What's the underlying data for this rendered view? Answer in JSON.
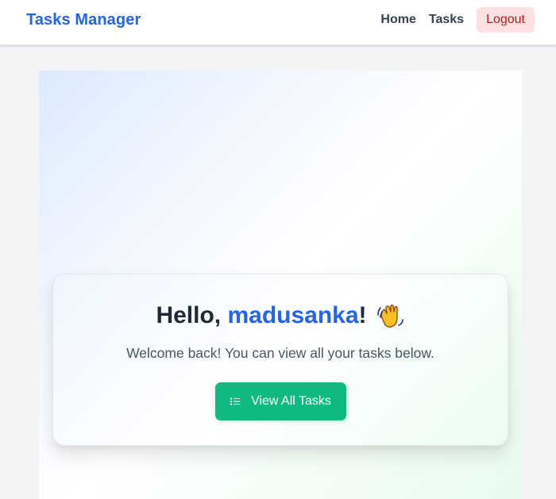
{
  "navbar": {
    "brand": "Tasks Manager",
    "links": [
      {
        "label": "Home"
      },
      {
        "label": "Tasks"
      }
    ],
    "logout_label": "Logout"
  },
  "welcome": {
    "greeting_prefix": "Hello, ",
    "username": "madusanka",
    "greeting_suffix": "!",
    "wave_icon": "waving-hand-icon",
    "subtitle": "Welcome back! You can view all your tasks below.",
    "button_label": "View All Tasks",
    "button_icon": "list-icon"
  },
  "colors": {
    "brand": "#2563eb",
    "accent_button": "#10b981",
    "logout_bg": "#fee2e2",
    "logout_text": "#b91c1c"
  }
}
